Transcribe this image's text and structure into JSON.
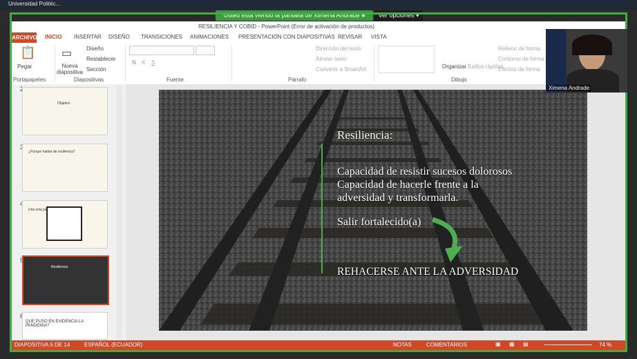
{
  "zoom": {
    "app_title": "Universidad Politéc...",
    "share_banner": "Usted está viendo la pantalla de Ximena Andrade",
    "view_options": "Ver opciones",
    "participant_name": "Ximena Andrade"
  },
  "ppt": {
    "window_title": "RESILIENCIA Y COBID - PowerPoint (Error de activación de productos)",
    "tabs": [
      "ARCHIVO",
      "INICIO",
      "INSERTAR",
      "DISEÑO",
      "TRANSICIONES",
      "ANIMACIONES",
      "PRESENTACIÓN CON DIAPOSITIVAS",
      "REVISAR",
      "VISTA"
    ],
    "ribbon": {
      "paste": "Pegar",
      "clipboard_group": "Portapapeles",
      "new_slide": "Nueva diapositiva",
      "layout": "Diseño",
      "reset": "Restablecer",
      "section": "Sección",
      "slides_group": "Diapositivas",
      "font_group": "Fuente",
      "text_direction": "Dirección del texto",
      "align_text": "Alinear texto",
      "convert_smartart": "Convertir a SmartArt",
      "paragraph_group": "Párrafo",
      "arrange": "Organizar",
      "quick_styles": "Estilos rápidos",
      "shape_fill": "Relleno de forma",
      "shape_outline": "Contorno de forma",
      "shape_effects": "Efectos de forma",
      "drawing_group": "Dibujo"
    },
    "thumbnails": [
      {
        "num": "2",
        "text": "Objetivo"
      },
      {
        "num": "3",
        "text": "¿Porque hablar de resiliencia?"
      },
      {
        "num": "4",
        "text": "Una sola palabra o expresión"
      },
      {
        "num": "5",
        "text": "Resiliencia"
      },
      {
        "num": "6",
        "text": "QUE PUSO EN EVIDENCIA LA PANDEMIA?"
      }
    ],
    "slide": {
      "title": "Resiliencia:",
      "line1": "Capacidad de resistir sucesos dolorosos",
      "line2": "Capacidad de hacerle  frente a la",
      "line3": "adversidad y transformarla.",
      "line4": "Salir fortalecido(a)",
      "line5": "REHACERSE ANTE LA ADVERSIDAD"
    },
    "status": {
      "slide_info": "DIAPOSITIVA 5 DE 14",
      "language": "ESPAÑOL (ECUADOR)",
      "notes": "NOTAS",
      "comments": "COMENTARIOS",
      "zoom": "74 %"
    }
  }
}
